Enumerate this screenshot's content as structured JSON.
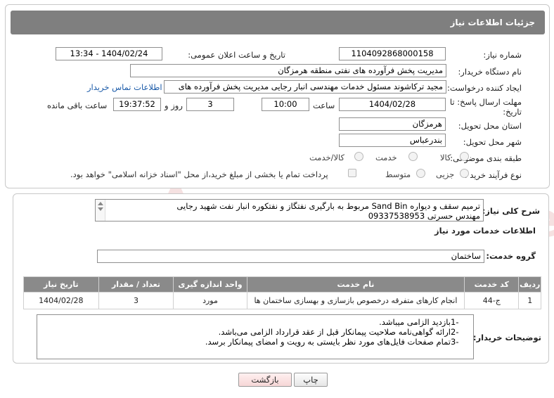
{
  "header": {
    "title": "جزئیات اطلاعات نیاز"
  },
  "form": {
    "need_number_label": "شماره نیاز:",
    "need_number": "1104092868000158",
    "announce_label": "تاریخ و ساعت اعلان عمومی:",
    "announce_value": "1404/02/24 - 13:34",
    "buyer_org_label": "نام دستگاه خریدار:",
    "buyer_org": "مدیریت پخش فرآورده های نفتی منطقه هرمزگان",
    "creator_label": "ایجاد کننده درخواست:",
    "creator": "مجید ترکاشوند مسئول خدمات مهندسی انبار رجایی مدیریت پخش فرآورده های",
    "contact_link": "اطلاعات تماس خریدار",
    "deadline_label_1": "مهلت ارسال پاسخ: تا",
    "deadline_label_2": "تاریخ:",
    "deadline_date": "1404/02/28",
    "time_label": "ساعت",
    "deadline_time": "10:00",
    "days_value": "3",
    "days_label": "روز و",
    "remaining_time": "19:37:52",
    "remaining_label": "ساعت باقی مانده",
    "province_label": "استان محل تحویل:",
    "province": "هرمزگان",
    "city_label": "شهر محل تحویل:",
    "city": "بندرعباس",
    "category_label": "طبقه بندی موضوعی:",
    "category_options": [
      "کالا",
      "خدمت",
      "کالا/خدمت"
    ],
    "process_label": "نوع فرآیند خرید :",
    "process_options": [
      "جزیی",
      "متوسط"
    ],
    "payment_note": "پرداخت تمام یا بخشی از مبلغ خرید،از محل \"اسناد خزانه اسلامی\" خواهد بود."
  },
  "details": {
    "summary_label": "شرح کلی نیاز:",
    "summary_line1": "ترمیم سقف و دیواره Sand Bin مربوط به بارگیری نفتگاز و نفتکوره انبار نفت شهید رجایی",
    "summary_line2": "مهندس حسرتی 09337538953",
    "services_title": "اطلاعات خدمات مورد نیاز",
    "service_group_label": "گروه خدمت:",
    "service_group": "ساختمان",
    "table": {
      "headers": [
        "ردیف",
        "کد خدمت",
        "نام خدمت",
        "واحد اندازه گیری",
        "تعداد / مقدار",
        "تاریخ نیاز"
      ],
      "rows": [
        [
          "1",
          "ج-44",
          "انجام کارهای متفرقه درخصوص بازسازی و بهسازی ساختمان ها",
          "مورد",
          "3",
          "1404/02/28"
        ]
      ]
    },
    "notes_label": "توضیحات خریدار:",
    "notes": [
      {
        "num": "1-",
        "text": "بازدید الزامی میباشد."
      },
      {
        "num": "2-",
        "text": "ارائه گواهی‌نامه صلاحیت پیمانکار قبل از عقد قرارداد الزامی می‌باشد."
      },
      {
        "num": "3-",
        "text": "تمام صفحات فایل‌های مورد نظر بایستی به رویت و امضای پیمانکار برسد."
      }
    ]
  },
  "buttons": {
    "print": "چاپ",
    "back": "بازگشت"
  },
  "watermark": {
    "text": "AriaTender.neT",
    "color": "#b22222"
  }
}
